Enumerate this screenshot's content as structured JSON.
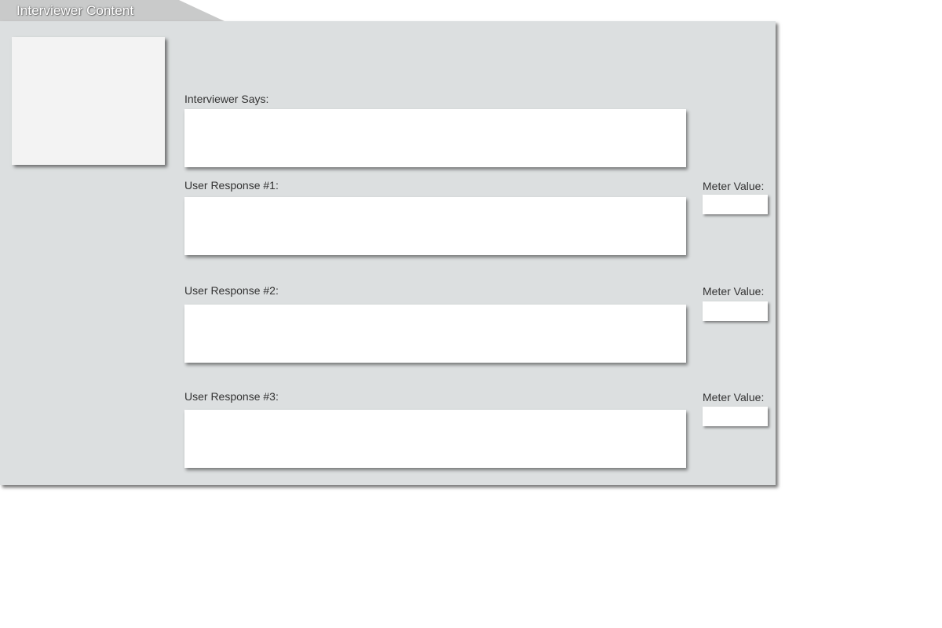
{
  "window": {
    "title": "Interviewer Content"
  },
  "avatar": {
    "icon": "avatar-placeholder"
  },
  "interviewer": {
    "label": "Interviewer Says:",
    "value": ""
  },
  "responses": [
    {
      "label": "User Response #1:",
      "value": "",
      "meter_label": "Meter Value:",
      "meter_value": ""
    },
    {
      "label": "User Response #2:",
      "value": "",
      "meter_label": "Meter Value:",
      "meter_value": ""
    },
    {
      "label": "User Response #3:",
      "value": "",
      "meter_label": "Meter Value:",
      "meter_value": ""
    }
  ],
  "colors": {
    "panel_background": "#dcdfe0",
    "title_tab_background": "#c9caca",
    "field_background": "#ffffff",
    "label_text": "#333333"
  }
}
